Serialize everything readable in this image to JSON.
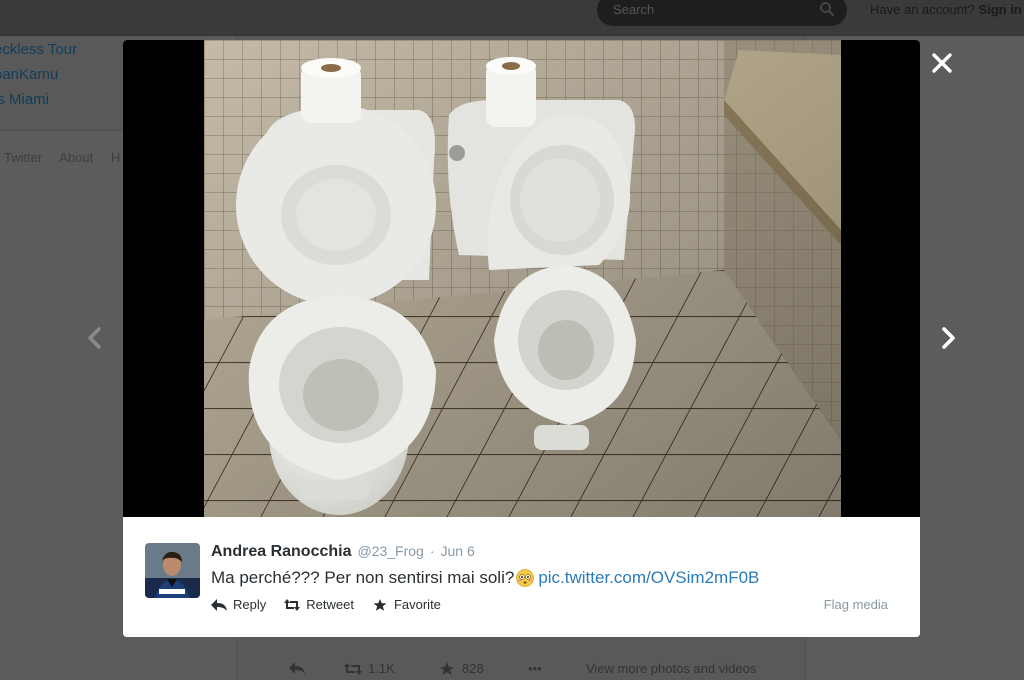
{
  "header": {
    "search_placeholder": "Search",
    "account_prompt": "Have an account?",
    "sign_in_label": "Sign in"
  },
  "sidebar": {
    "trends": [
      "eckless Tour",
      "oanKamu",
      "is Miami"
    ],
    "footer_links": [
      "Twitter",
      "About",
      "H"
    ]
  },
  "background_actions": {
    "retweet_count": "1.1K",
    "favorite_count": "828",
    "more_label": "•••",
    "view_more_label": "View more photos and videos"
  },
  "tweet": {
    "full_name": "Andrea Ranocchia",
    "username": "@23_Frog",
    "separator": "·",
    "timestamp": "Jun 6",
    "text": "Ma perché??? Per non sentirsi mai soli?",
    "emoji_name": "flushed-face-emoji",
    "link": "pic.twitter.com/OVSim2mF0B",
    "actions": {
      "reply": "Reply",
      "retweet": "Retweet",
      "favorite": "Favorite"
    },
    "flag_label": "Flag media"
  },
  "icons": {
    "close": "close-icon",
    "prev": "chevron-left-icon",
    "next": "chevron-right-icon",
    "search": "search-icon"
  },
  "colors": {
    "link": "#2b7bb9",
    "overlay": "#5c5c5c",
    "media_bg": "#000000"
  }
}
